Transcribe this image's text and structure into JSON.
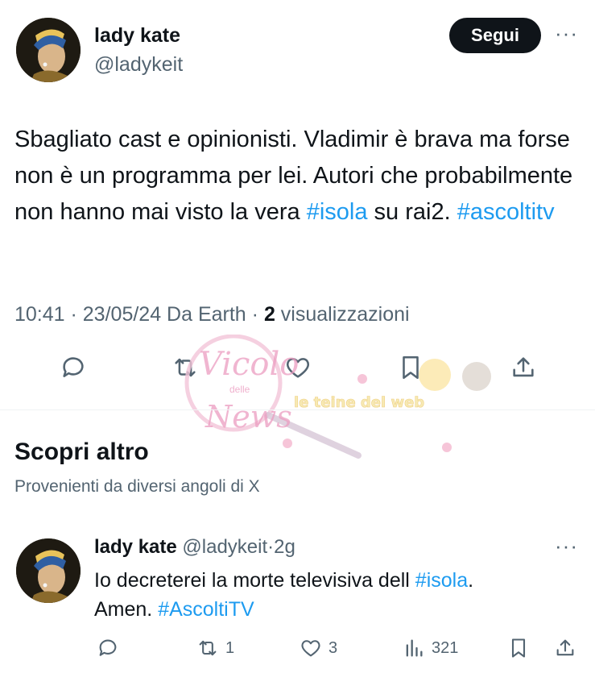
{
  "tweet": {
    "author_name": "lady kate",
    "author_handle": "@ladykeit",
    "follow_label": "Segui",
    "more_label": "···",
    "text_plain_1": "Sbagliato cast e opinionisti. Vladimir è brava ma forse non è un programma per lei. Autori che probabilmente non hanno mai visto la vera ",
    "hashtag_1": "#isola",
    "text_plain_2": " su rai2. ",
    "hashtag_2": "#ascoltitv",
    "time": "10:41",
    "sep1": " · ",
    "date": "23/05/24",
    "source": " Da Earth",
    "sep2": " · ",
    "views_count": "2",
    "views_label": " visualizzazioni"
  },
  "actions": {
    "icons": [
      "reply-icon",
      "retweet-icon",
      "like-icon",
      "bookmark-icon",
      "share-icon"
    ]
  },
  "watermark": {
    "logo_text_1": "Vicolo",
    "logo_text_2": "delle",
    "logo_text_3": "News",
    "banner_text": "le teine del web"
  },
  "discover": {
    "title": "Scopri altro",
    "subtitle": "Provenienti da diversi angoli di X"
  },
  "reply": {
    "author_name": "lady kate",
    "author_handle": " @ladykeit",
    "sep": "·",
    "age": "2g",
    "more_label": "···",
    "text_1": "Io decreterei la morte televisiva dell ",
    "hashtag_1": "#isola",
    "text_2": ".",
    "text_3": "Amen. ",
    "hashtag_2": "#AscoltiTV",
    "retweets": "1",
    "likes": "3",
    "views": "321"
  },
  "colors": {
    "text": "#0f1419",
    "secondary": "#536471",
    "link": "#1d9bf0",
    "button_bg": "#0f1419"
  }
}
